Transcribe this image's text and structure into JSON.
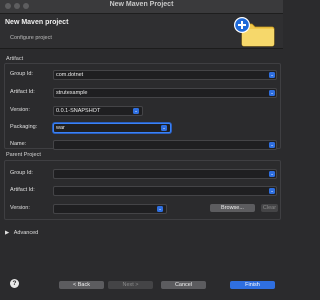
{
  "window": {
    "title": "New Maven Project"
  },
  "header": {
    "title": "New Maven project",
    "subtitle": "Configure project",
    "logo_icon": "maven-new-project-icon"
  },
  "artifact": {
    "group_label": "Artifact",
    "group_id": {
      "label": "Group Id:",
      "value": "com.dotnet"
    },
    "artifact_id": {
      "label": "Artifact Id:",
      "value": "strutexample"
    },
    "version": {
      "label": "Version:",
      "value": "0.0.1-SNAPSHOT"
    },
    "packaging": {
      "label": "Packaging:",
      "value": "war"
    },
    "name": {
      "label": "Name:",
      "value": ""
    }
  },
  "parent": {
    "group_label": "Parent Project",
    "group_id": {
      "label": "Group Id:",
      "value": ""
    },
    "artifact_id": {
      "label": "Artifact Id:",
      "value": ""
    },
    "version": {
      "label": "Version:",
      "value": ""
    },
    "browse_label": "Browse...",
    "clear_label": "Clear"
  },
  "advanced": {
    "arrow": "▶",
    "label": "Advanced"
  },
  "footer": {
    "help_label": "?",
    "back_label": "< Back",
    "next_label": "Next >",
    "cancel_label": "Cancel",
    "finish_label": "Finish"
  },
  "colors": {
    "accent": "#2f6fe0",
    "background": "#2b2b2d",
    "field_bg": "#1f1f21"
  }
}
